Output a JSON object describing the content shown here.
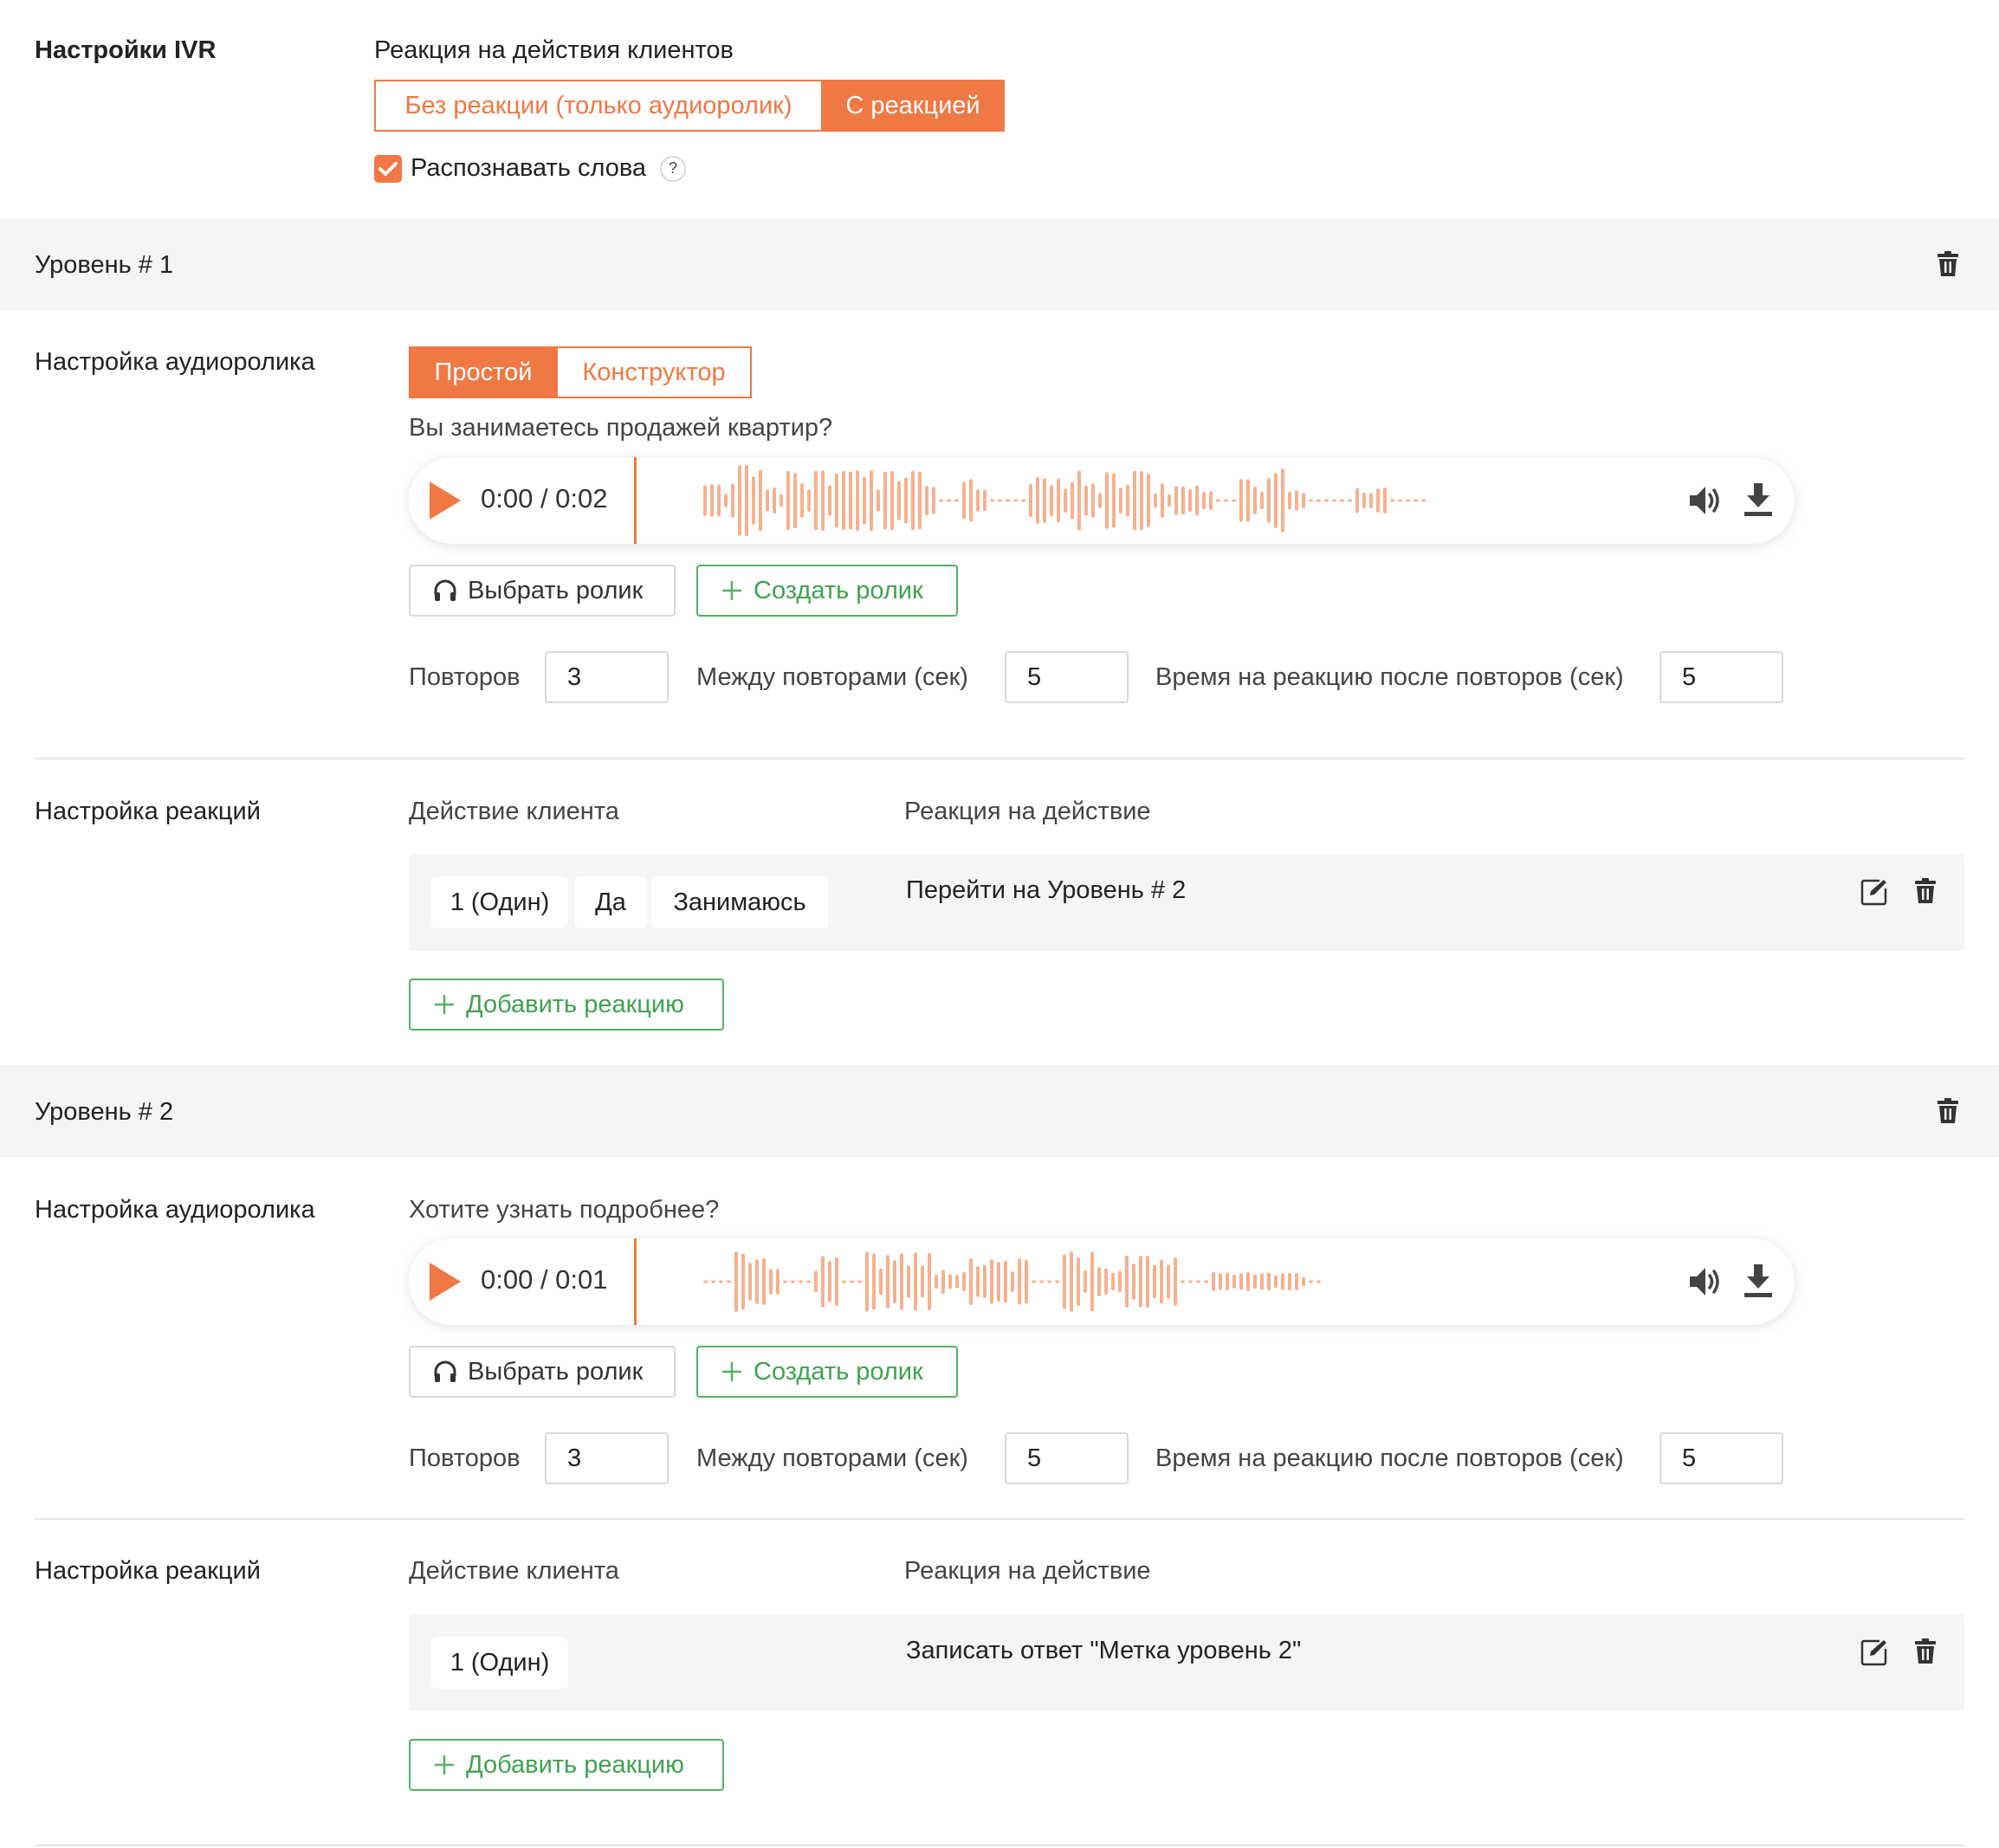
{
  "settings": {
    "title": "Настройки IVR",
    "reaction_label": "Реакция на действия клиентов",
    "reaction_options": [
      "Без реакции (только аудиоролик)",
      "С реакцией"
    ],
    "reaction_selected": 1,
    "recognize_label": "Распознавать слова",
    "recognize_checked": true,
    "help_glyph": "?"
  },
  "levels": [
    {
      "title": "Уровень # 1",
      "audio_label": "Настройка аудиоролика",
      "mode_options": [
        "Простой",
        "Конструктор"
      ],
      "mode_selected": 0,
      "audio_text": "Вы занимаетесь продажей квартир?",
      "player_time": "0:00 / 0:02",
      "select_button": "Выбрать ролик",
      "create_button": "Создать ролик",
      "repeats_label": "Повторов",
      "repeats_value": "3",
      "between_label": "Между повторами (сек)",
      "between_value": "5",
      "reaction_time_label": "Время на реакцию после повторов (сек)",
      "reaction_time_value": "5",
      "reactions_label": "Настройка реакций",
      "action_header": "Действие клиента",
      "reaction_header": "Реакция на действие",
      "reactions": [
        {
          "tags": [
            "1 (Один)",
            "Да",
            "Занимаюсь"
          ],
          "reaction": "Перейти на Уровень # 2"
        }
      ],
      "add_reaction_button": "Добавить реакцию"
    },
    {
      "title": "Уровень # 2",
      "audio_label": "Настройка аудиоролика",
      "audio_text": "Хотите узнать подробнее?",
      "player_time": "0:00 / 0:01",
      "select_button": "Выбрать ролик",
      "create_button": "Создать ролик",
      "repeats_label": "Повторов",
      "repeats_value": "3",
      "between_label": "Между повторами (сек)",
      "between_value": "5",
      "reaction_time_label": "Время на реакцию после повторов (сек)",
      "reaction_time_value": "5",
      "reactions_label": "Настройка реакций",
      "action_header": "Действие клиента",
      "reaction_header": "Реакция на действие",
      "reactions": [
        {
          "tags": [
            "1 (Один)"
          ],
          "reaction": "Записать ответ \"Метка уровень 2\""
        }
      ],
      "add_reaction_button": "Добавить реакцию"
    }
  ],
  "icons": {
    "play": "play-icon",
    "volume": "volume-icon",
    "download": "download-icon",
    "headphones": "headphones-icon",
    "plus": "plus-icon",
    "edit": "edit-icon",
    "trash": "trash-icon",
    "check": "check-icon"
  },
  "colors": {
    "accent": "#f07844",
    "waveform": "#f7b08e",
    "success": "#52b262",
    "band": "#f5f5f5",
    "border": "#d9d9d9"
  }
}
